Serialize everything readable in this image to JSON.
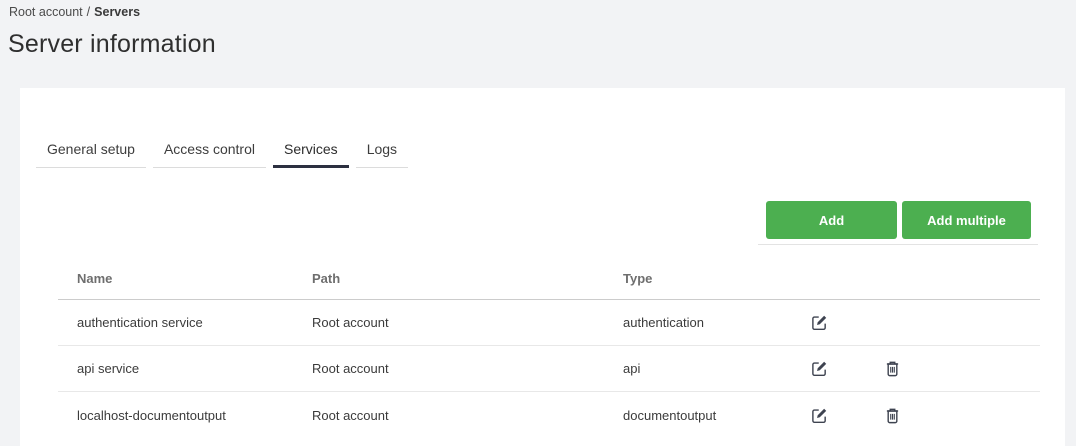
{
  "breadcrumb": {
    "root": "Root account",
    "separator": "/",
    "current": "Servers"
  },
  "page": {
    "title": "Server information"
  },
  "tabs": [
    {
      "label": "General setup",
      "active": false
    },
    {
      "label": "Access control",
      "active": false
    },
    {
      "label": "Services",
      "active": true
    },
    {
      "label": "Logs",
      "active": false
    }
  ],
  "toolbar": {
    "add": "Add",
    "add_multiple": "Add multiple"
  },
  "table": {
    "headers": {
      "name": "Name",
      "path": "Path",
      "type": "Type"
    },
    "rows": [
      {
        "name": "authentication service",
        "path": "Root account",
        "type": "authentication",
        "can_edit": true,
        "can_delete": false
      },
      {
        "name": "api service",
        "path": "Root account",
        "type": "api",
        "can_edit": true,
        "can_delete": true
      },
      {
        "name": "localhost-documentoutput",
        "path": "Root account",
        "type": "documentoutput",
        "can_edit": true,
        "can_delete": true
      }
    ]
  },
  "colors": {
    "page_bg": "#f2f3f5",
    "card_bg": "#ffffff",
    "accent_green": "#4caf50",
    "active_tab_underline": "#2c3040",
    "icon": "#3e4350"
  }
}
